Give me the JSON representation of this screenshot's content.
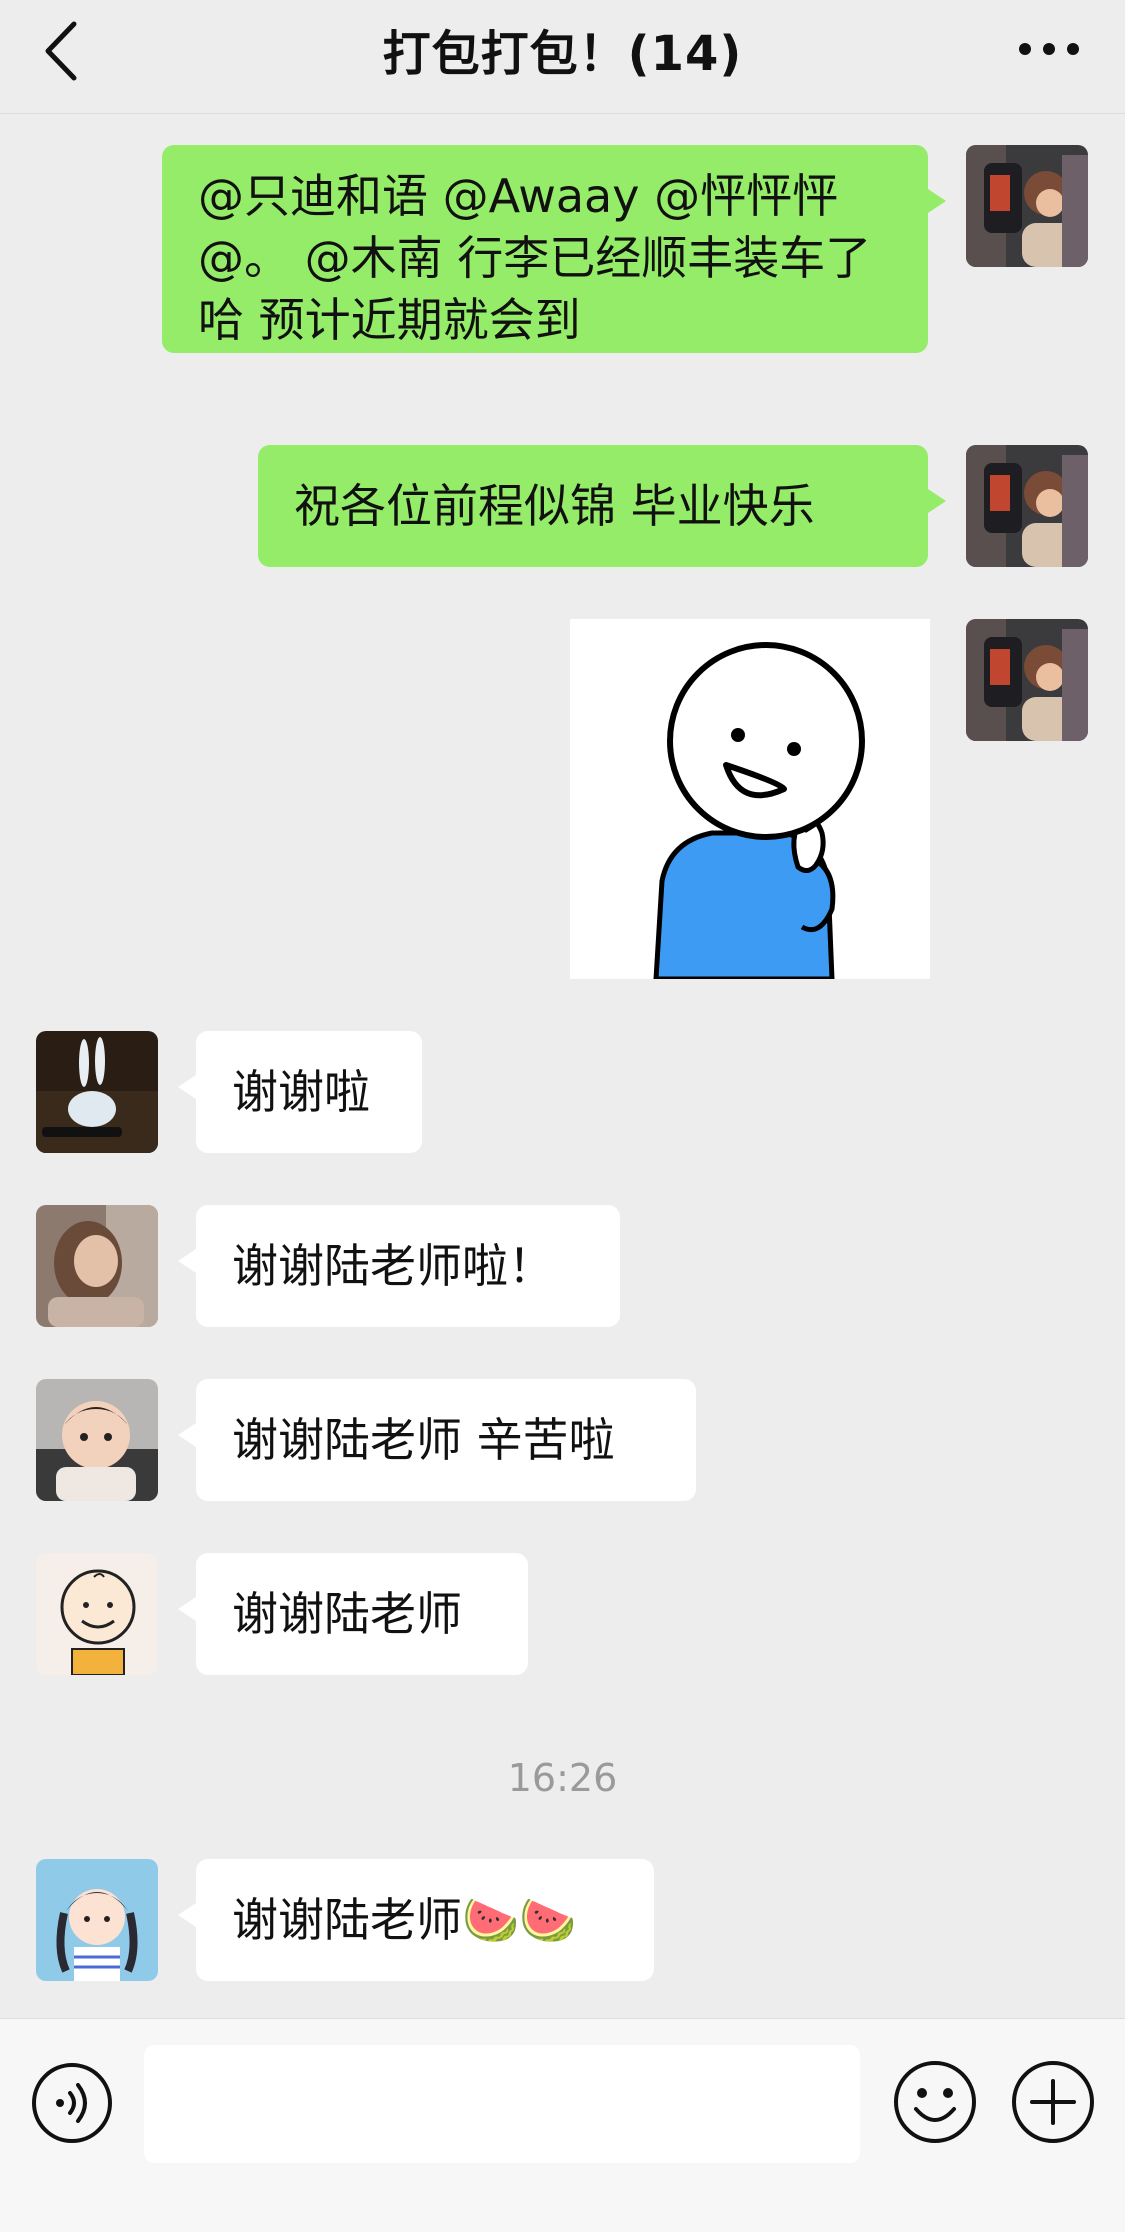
{
  "header": {
    "title": "打包打包！(14)",
    "back_icon": "chevron-left-icon",
    "more_icon": "more-dots-icon"
  },
  "messages": [
    {
      "side": "mine",
      "type": "text",
      "text": "@只迪和语 @Awaay @怦怦怦 @。 @木南 行李已经顺丰装车了哈 预计近期就会到"
    },
    {
      "side": "mine",
      "type": "text",
      "text": "祝各位前程似锦 毕业快乐"
    },
    {
      "side": "mine",
      "type": "sticker",
      "sticker": "smiling-stick-figure-heart-sticker"
    },
    {
      "side": "theirs",
      "type": "text",
      "text": "谢谢啦"
    },
    {
      "side": "theirs",
      "type": "text",
      "text": "谢谢陆老师啦！"
    },
    {
      "side": "theirs",
      "type": "text",
      "text": "谢谢陆老师 辛苦啦"
    },
    {
      "side": "theirs",
      "type": "text",
      "text": "谢谢陆老师"
    },
    {
      "type": "timestamp",
      "text": "16:26"
    },
    {
      "side": "theirs",
      "type": "text",
      "text": "谢谢陆老师🍉🍉"
    }
  ],
  "input_bar": {
    "voice_icon": "voice-icon",
    "input_value": "",
    "emoji_icon": "emoji-icon",
    "plus_icon": "plus-icon"
  },
  "colors": {
    "background": "#ededed",
    "my_bubble": "#95ec69",
    "their_bubble": "#ffffff",
    "timestamp": "#9a9a9a"
  }
}
